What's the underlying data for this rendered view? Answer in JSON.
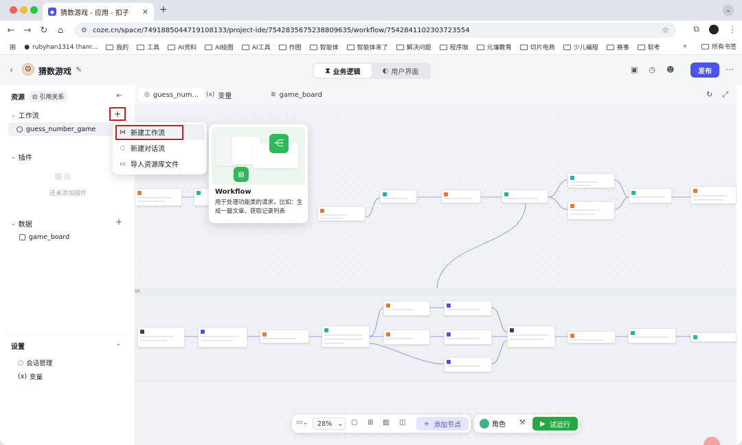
{
  "browser": {
    "tab_title": "猜数游戏 - 应用 - 扣子",
    "tab_favicon": "coze-logo-icon",
    "url": "coze.cn/space/7491885044719108133/project-ide/7542835675238809635/workflow/7542841102303723554",
    "bookmarks": [
      "rubyhan1314 (hanr...",
      "我的",
      "工具",
      "AI资料",
      "AI绘图",
      "AI工具",
      "作图",
      "智能体",
      "智能体来了",
      "解决问题",
      "程序咖",
      "元壤教育",
      "切片电商",
      "少儿编程",
      "赛事",
      "软考"
    ],
    "bookmarks_more": "»",
    "all_bookmarks": "所有书签"
  },
  "header": {
    "app_name": "猜数游戏",
    "tabs": [
      {
        "label": "业务逻辑",
        "active": true
      },
      {
        "label": "用户界面",
        "active": false
      }
    ],
    "publish_label": "发布"
  },
  "left_panel": {
    "title": "资源",
    "ref_label": "引用关系",
    "workflow_section": "工作流",
    "workflow_item": "guess_number_game",
    "plugin_section": "插件",
    "plugin_empty": "还未添加插件",
    "data_section": "数据",
    "data_item": "game_board",
    "settings_title": "设置",
    "settings_items": [
      "会话管理",
      "变量"
    ],
    "settings_var_prefix": "(x)"
  },
  "menu": {
    "items": [
      {
        "label": "新建工作流",
        "icon": "workflow-icon"
      },
      {
        "label": "新建对话流",
        "icon": "chatflow-icon"
      },
      {
        "label": "导入资源库文件",
        "icon": "import-icon"
      }
    ]
  },
  "preview": {
    "title": "Workflow",
    "description": "用于处理功能类的请求，比如：生成一篇文章、获取记录列表"
  },
  "canvas": {
    "tabs": [
      {
        "label": "guess_num...",
        "icon": "workflow-icon"
      },
      {
        "label": "变量",
        "icon": "variable-icon",
        "prefix": "(x)"
      },
      {
        "label": "game_board",
        "icon": "database-icon"
      }
    ],
    "loop_label": "10"
  },
  "bottom_bar": {
    "zoom": "28%",
    "add_node_label": "添加节点",
    "role_label": "角色",
    "run_label": "试运行"
  },
  "colors": {
    "accent": "#4d53e8",
    "run_green": "#27a844",
    "highlight_red": "#c0202a"
  }
}
